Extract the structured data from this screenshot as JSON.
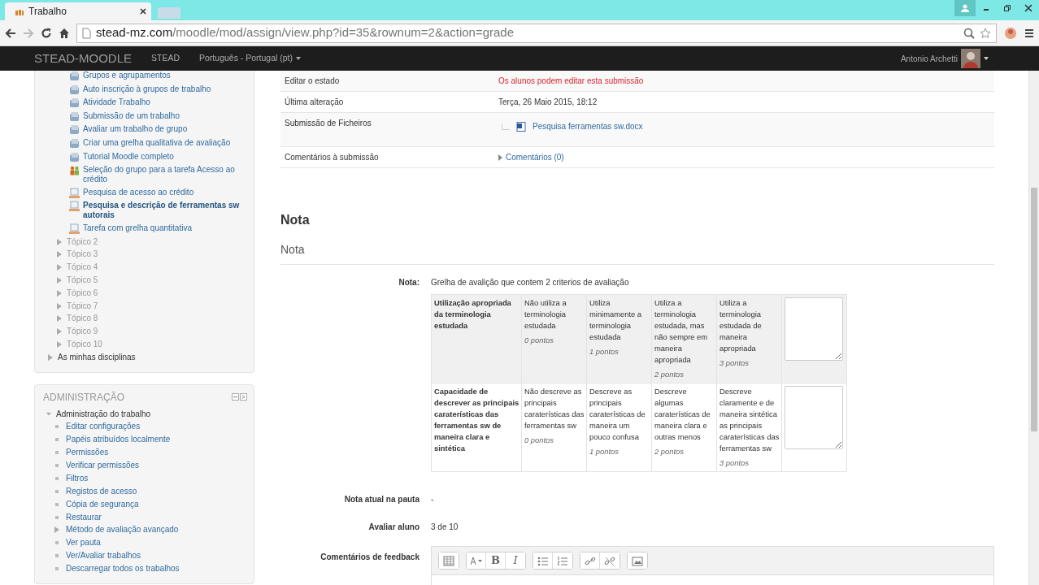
{
  "browser": {
    "tab_title": "Trabalho",
    "url_domain": "stead-mz.com",
    "url_path": "/moodle/mod/assign/view.php?id=35&rownum=2&action=grade"
  },
  "navbar": {
    "brand": "STEAD-MOODLE",
    "links": [
      "STEAD"
    ],
    "language": "Português - Portugal (pt)",
    "user": "Antonio Archetti"
  },
  "navigation": {
    "activities": [
      {
        "kind": "page",
        "label": "Grupos e agrupamentos",
        "current": false
      },
      {
        "kind": "page",
        "label": "Auto inscrição à grupos de trabalho",
        "current": false
      },
      {
        "kind": "page",
        "label": "Atividade Trabalho",
        "current": false
      },
      {
        "kind": "page",
        "label": "Submissão de um trabalho",
        "current": false
      },
      {
        "kind": "page",
        "label": "Avaliar um trabalho de grupo",
        "current": false
      },
      {
        "kind": "page",
        "label": "Criar uma grelha qualitativa de avaliação",
        "current": false
      },
      {
        "kind": "page",
        "label": "Tutorial Moodle completo",
        "current": false
      },
      {
        "kind": "group",
        "label": "Seleção do grupo para a tarefa Acesso ao crédito",
        "current": false
      },
      {
        "kind": "assign",
        "label": "Pesquisa de acesso ao crédito",
        "current": false
      },
      {
        "kind": "assign",
        "label": "Pesquisa e descrição de ferramentas sw autorais",
        "current": true
      },
      {
        "kind": "assign",
        "label": "Tarefa com grelha quantitativa",
        "current": false
      }
    ],
    "topics": [
      "Tópico 2",
      "Tópico 3",
      "Tópico 4",
      "Tópico 5",
      "Tópico 6",
      "Tópico 7",
      "Tópico 8",
      "Tópico 9",
      "Tópico 10"
    ],
    "my_courses": "As minhas disciplinas"
  },
  "administration": {
    "title": "ADMINISTRAÇÃO",
    "root": {
      "label": "Administração do trabalho",
      "expanded": true,
      "children": [
        {
          "kind": "leaf",
          "label": "Editar configurações"
        },
        {
          "kind": "leaf",
          "label": "Papéis atribuídos localmente"
        },
        {
          "kind": "leaf",
          "label": "Permissões"
        },
        {
          "kind": "leaf",
          "label": "Verificar permissões"
        },
        {
          "kind": "leaf",
          "label": "Filtros"
        },
        {
          "kind": "leaf",
          "label": "Registos de acesso"
        },
        {
          "kind": "leaf",
          "label": "Cópia de segurança"
        },
        {
          "kind": "leaf",
          "label": "Restaurar"
        },
        {
          "kind": "branch",
          "label": "Método de avaliação avançado"
        },
        {
          "kind": "leaf",
          "label": "Ver pauta"
        },
        {
          "kind": "leaf",
          "label": "Ver/Avaliar trabalhos"
        },
        {
          "kind": "leaf",
          "label": "Descarregar todos os trabalhos"
        }
      ]
    }
  },
  "submission": [
    {
      "kind": "warning",
      "label": "Editar o estado",
      "value": "Os alunos podem editar esta submissão"
    },
    {
      "kind": "text",
      "label": "Última alteração",
      "value": "Terça, 26 Maio 2015, 18:12"
    },
    {
      "kind": "file",
      "label": "Submissão de Ficheiros",
      "value": "Pesquisa ferramentas sw.docx"
    },
    {
      "kind": "comments",
      "label": "Comentários à submissão",
      "value": "Comentários (0)"
    }
  ],
  "grade": {
    "heading": "Nota",
    "subheading": "Nota",
    "label": "Nota:",
    "description": "Grelha de avalição que contem 2 criterios de avaliação",
    "rubric": [
      {
        "highlighted": true,
        "criterion": "Utilização apropriada da terminologia estudada",
        "levels": [
          {
            "text": "Não utiliza a terminologia estudada",
            "points": "0 pontos"
          },
          {
            "text": "Utiliza minimamente a terminologia estudada",
            "points": "1 pontos"
          },
          {
            "text": "Utiliza a terminologia estudada, mas não sempre em maneira apropriada",
            "points": "2 pontos"
          },
          {
            "text": "Utiliza a terminologia estudada de maneira apropriada",
            "points": "3 pontos"
          }
        ]
      },
      {
        "highlighted": false,
        "criterion": "Capacidade de descrever as principais caraterísticas das ferramentas sw de maneira clara e sintética",
        "levels": [
          {
            "text": "Não descreve as principais caraterísticas das ferramentas sw",
            "points": "0 pontos"
          },
          {
            "text": "Descreve as principais caraterísticas de maneira um pouco confusa",
            "points": "1 pontos"
          },
          {
            "text": "Descreve algumas caraterísticas de maneira clara e outras menos",
            "points": "2 pontos"
          },
          {
            "text": "Descreve claramente e de maneira sintética as principais caraterísticas das ferramentas sw",
            "points": "3 pontos"
          }
        ]
      }
    ],
    "fields": [
      {
        "label": "Nota atual na pauta",
        "value": "-"
      },
      {
        "label": "Avaliar aluno",
        "value": "3 de 10"
      }
    ],
    "feedback_label": "Comentários de feedback",
    "toolbar": [
      [
        {
          "kind": "grid"
        }
      ],
      [
        {
          "kind": "font"
        },
        {
          "kind": "bold",
          "label": "B"
        },
        {
          "kind": "italic",
          "label": "I"
        }
      ],
      [
        {
          "kind": "ul"
        },
        {
          "kind": "ol"
        }
      ],
      [
        {
          "kind": "link"
        },
        {
          "kind": "unlink"
        }
      ],
      [
        {
          "kind": "image"
        }
      ]
    ]
  }
}
